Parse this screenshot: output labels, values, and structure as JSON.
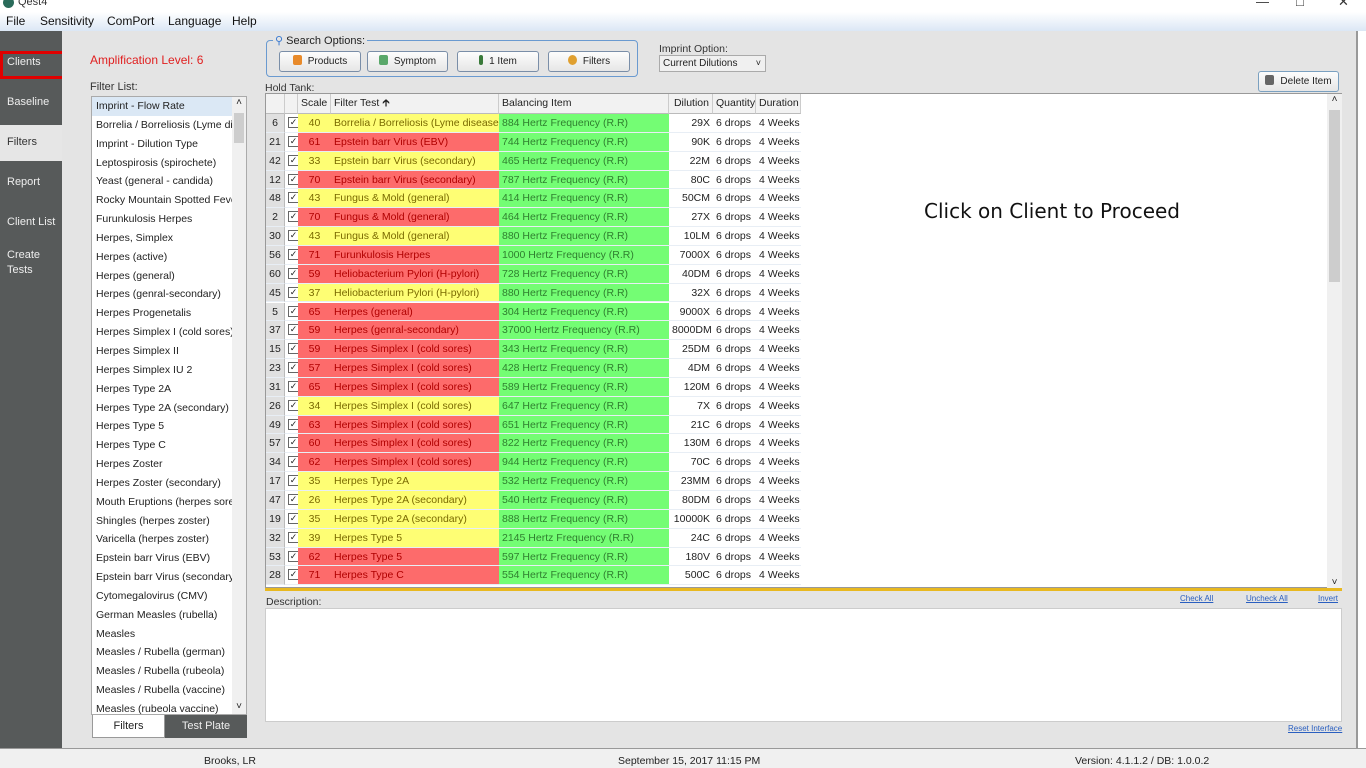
{
  "app": {
    "title": "Qest4"
  },
  "menu": [
    "File",
    "Sensitivity",
    "ComPort",
    "Language",
    "Help"
  ],
  "sidebar": [
    {
      "label": "Clients"
    },
    {
      "label": "Baseline"
    },
    {
      "label": "Filters"
    },
    {
      "label": "Report"
    },
    {
      "label": "Client List"
    },
    {
      "label": "Create Tests"
    }
  ],
  "amplification": "Amplification Level: 6",
  "filter_list": {
    "label": "Filter List:",
    "items": [
      "Imprint - Flow Rate",
      "Borrelia / Borreliosis (Lyme disease)",
      "Imprint - Dilution Type",
      "Leptospirosis (spirochete)",
      "Yeast (general - candida)",
      "Rocky Mountain Spotted Fever",
      "Furunkulosis Herpes",
      "Herpes, Simplex",
      "Herpes (active)",
      "Herpes (general)",
      "Herpes (genral-secondary)",
      "Herpes Progenetalis",
      "Herpes Simplex I (cold sores)",
      "Herpes Simplex II",
      "Herpes Simplex IU 2",
      "Herpes Type 2A",
      "Herpes Type 2A (secondary)",
      "Herpes Type 5",
      "Herpes Type C",
      "Herpes Zoster",
      "Herpes Zoster (secondary)",
      "Mouth Eruptions (herpes sores)",
      "Shingles (herpes zoster)",
      "Varicella (herpes zoster)",
      "Epstein barr Virus (EBV)",
      "Epstein barr Virus (secondary)",
      "Cytomegalovirus (CMV)",
      "German Measles (rubella)",
      "Measles",
      "Measles / Rubella (german)",
      "Measles / Rubella (rubeola)",
      "Measles / Rubella (vaccine)",
      "Measles (rubeola vaccine)"
    ],
    "tabs": [
      "Filters",
      "Test Plate"
    ]
  },
  "search": {
    "label": "Search Options:",
    "buttons": [
      "Products",
      "Symptom",
      "1 Item",
      "Filters"
    ]
  },
  "imprint": {
    "label": "Imprint Option:",
    "value": "Current Dilutions"
  },
  "delete_label": "Delete Item",
  "hold_tank": {
    "label": "Hold Tank:",
    "columns": [
      "",
      "",
      "Scale",
      "Filter Test",
      "Balancing Item",
      "Dilution",
      "Quantity",
      "Duration"
    ],
    "rows": [
      [
        6,
        40,
        "Borrelia / Borreliosis (Lyme disease)",
        "884 Hertz Frequency (R.R)",
        "29X",
        "6 drops",
        "4 Weeks",
        "yellow"
      ],
      [
        21,
        61,
        "Epstein barr Virus (EBV)",
        "744 Hertz Frequency (R.R)",
        "90K",
        "6 drops",
        "4 Weeks",
        "red"
      ],
      [
        42,
        33,
        "Epstein barr Virus (secondary)",
        "465 Hertz Frequency (R.R)",
        "22M",
        "6 drops",
        "4 Weeks",
        "yellow"
      ],
      [
        12,
        70,
        "Epstein barr Virus (secondary)",
        "787 Hertz Frequency (R.R)",
        "80C",
        "6 drops",
        "4 Weeks",
        "red"
      ],
      [
        48,
        43,
        "Fungus & Mold (general)",
        "414 Hertz Frequency (R.R)",
        "50CM",
        "6 drops",
        "4 Weeks",
        "yellow"
      ],
      [
        2,
        70,
        "Fungus & Mold (general)",
        "464 Hertz Frequency (R.R)",
        "27X",
        "6 drops",
        "4 Weeks",
        "red"
      ],
      [
        30,
        43,
        "Fungus & Mold (general)",
        "880 Hertz Frequency (R.R)",
        "10LM",
        "6 drops",
        "4 Weeks",
        "yellow"
      ],
      [
        56,
        71,
        "Furunkulosis Herpes",
        "1000 Hertz Frequency (R.R)",
        "7000X",
        "6 drops",
        "4 Weeks",
        "red"
      ],
      [
        60,
        59,
        "Heliobacterium Pylori (H-pylori)",
        "728 Hertz Frequency (R.R)",
        "40DM",
        "6 drops",
        "4 Weeks",
        "red"
      ],
      [
        45,
        37,
        "Heliobacterium Pylori (H-pylori)",
        "880 Hertz Frequency (R.R)",
        "32X",
        "6 drops",
        "4 Weeks",
        "yellow"
      ],
      [
        5,
        65,
        "Herpes (general)",
        "304 Hertz Frequency (R.R)",
        "9000X",
        "6 drops",
        "4 Weeks",
        "red"
      ],
      [
        37,
        59,
        "Herpes (genral-secondary)",
        "37000 Hertz Frequency (R.R)",
        "8000DM",
        "6 drops",
        "4 Weeks",
        "red"
      ],
      [
        15,
        59,
        "Herpes Simplex I (cold sores)",
        "343 Hertz Frequency (R.R)",
        "25DM",
        "6 drops",
        "4 Weeks",
        "red"
      ],
      [
        23,
        57,
        "Herpes Simplex I (cold sores)",
        "428 Hertz Frequency (R.R)",
        "4DM",
        "6 drops",
        "4 Weeks",
        "red"
      ],
      [
        31,
        65,
        "Herpes Simplex I (cold sores)",
        "589 Hertz Frequency (R.R)",
        "120M",
        "6 drops",
        "4 Weeks",
        "red"
      ],
      [
        26,
        34,
        "Herpes Simplex I (cold sores)",
        "647 Hertz Frequency (R.R)",
        "7X",
        "6 drops",
        "4 Weeks",
        "yellow"
      ],
      [
        49,
        63,
        "Herpes Simplex I (cold sores)",
        "651 Hertz Frequency (R.R)",
        "21C",
        "6 drops",
        "4 Weeks",
        "red"
      ],
      [
        57,
        60,
        "Herpes Simplex I (cold sores)",
        "822 Hertz Frequency (R.R)",
        "130M",
        "6 drops",
        "4 Weeks",
        "red"
      ],
      [
        34,
        62,
        "Herpes Simplex I (cold sores)",
        "944 Hertz Frequency (R.R)",
        "70C",
        "6 drops",
        "4 Weeks",
        "red"
      ],
      [
        17,
        35,
        "Herpes Type 2A",
        "532 Hertz Frequency (R.R)",
        "23MM",
        "6 drops",
        "4 Weeks",
        "yellow"
      ],
      [
        47,
        26,
        "Herpes Type 2A (secondary)",
        "540 Hertz Frequency (R.R)",
        "80DM",
        "6 drops",
        "4 Weeks",
        "yellow"
      ],
      [
        19,
        35,
        "Herpes Type 2A (secondary)",
        "888 Hertz Frequency (R.R)",
        "10000K",
        "6 drops",
        "4 Weeks",
        "yellow"
      ],
      [
        32,
        39,
        "Herpes Type 5",
        "2145 Hertz Frequency (R.R)",
        "24C",
        "6 drops",
        "4 Weeks",
        "yellow"
      ],
      [
        53,
        62,
        "Herpes Type 5",
        "597 Hertz Frequency (R.R)",
        "180V",
        "6 drops",
        "4 Weeks",
        "red"
      ],
      [
        28,
        71,
        "Herpes Type C",
        "554 Hertz Frequency (R.R)",
        "500C",
        "6 drops",
        "4 Weeks",
        "red"
      ]
    ]
  },
  "colors": {
    "yellow": "#fefe74",
    "red": "#fd6b6b",
    "green": "#74fd74",
    "yellow_text": "#7a6a00",
    "red_text": "#b00000",
    "green_text": "#2f7f2f"
  },
  "proceed": "Click on Client to Proceed",
  "description": {
    "label": "Description:",
    "links": [
      "Check All",
      "Uncheck All",
      "Invert"
    ],
    "reset": "Reset Interface"
  },
  "status": {
    "user": "Brooks, LR",
    "datetime": "September 15, 2017  11:15 PM",
    "version": "Version: 4.1.1.2 / DB: 1.0.0.2"
  }
}
